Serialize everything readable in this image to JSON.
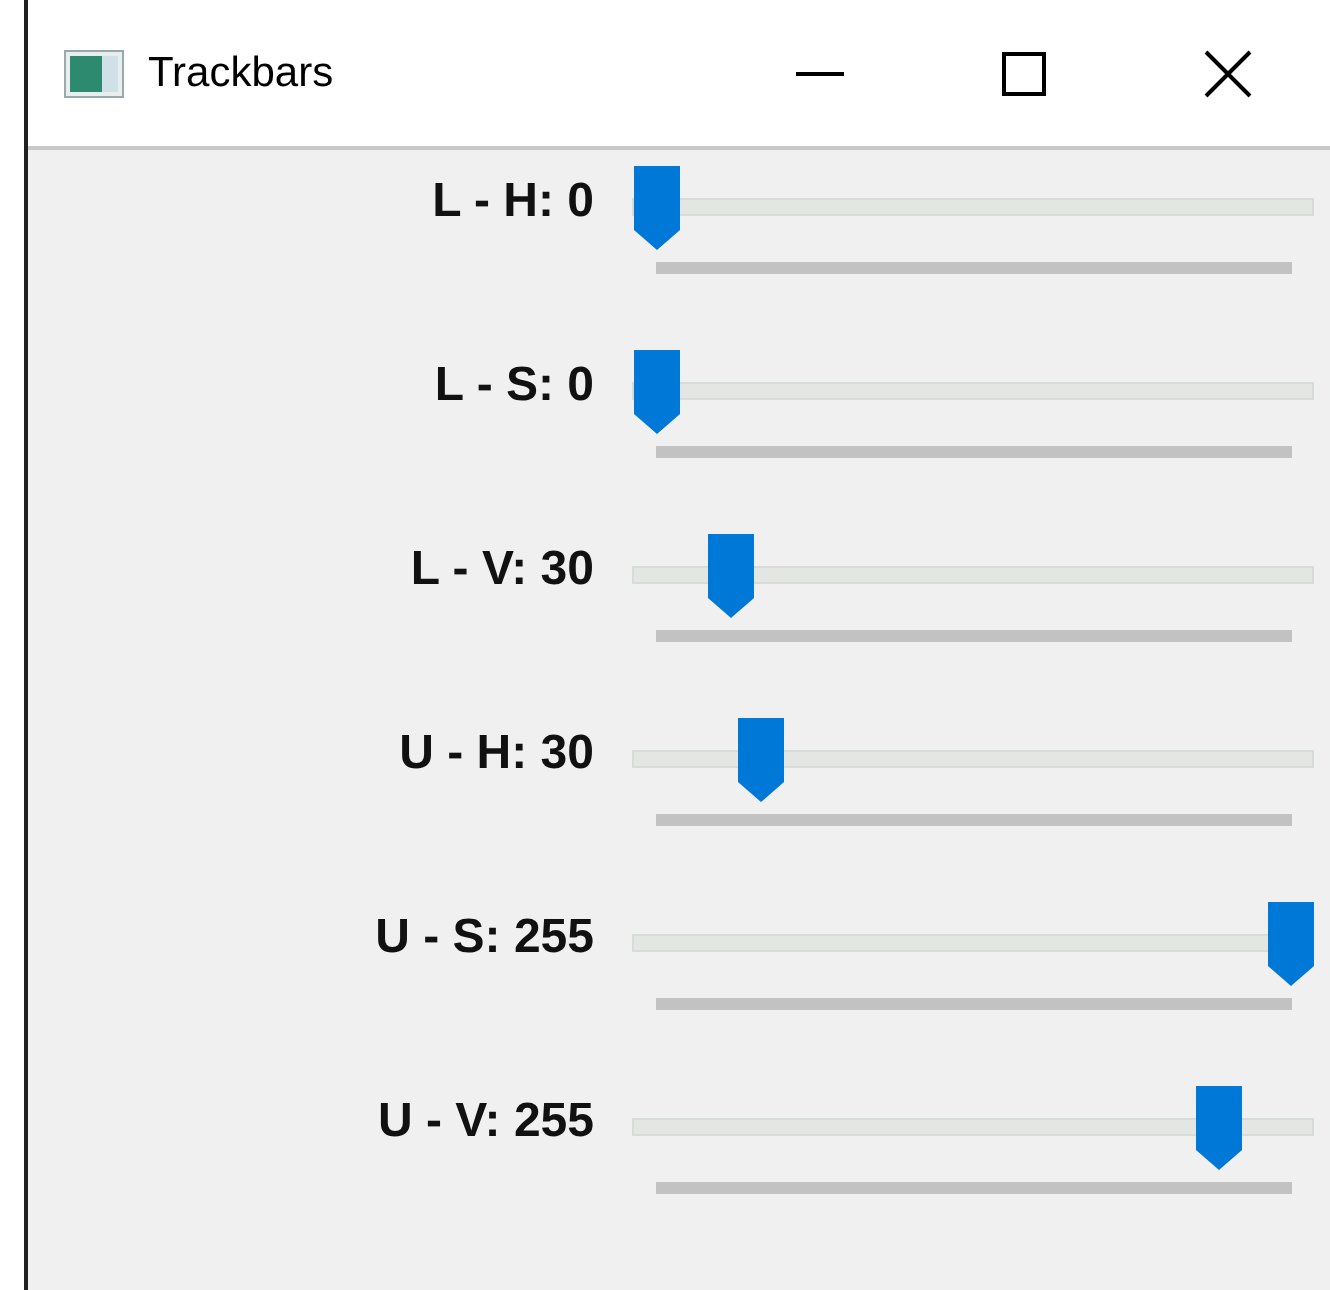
{
  "window": {
    "title": "Trackbars"
  },
  "trackbars": [
    {
      "label": "L - H: 0",
      "level": 0
    },
    {
      "label": "L - S: 0",
      "level": 0
    },
    {
      "label": "L - V: 30",
      "level": 0.117
    },
    {
      "label": "U - H: 30",
      "level": 0.164
    },
    {
      "label": "U - S: 255",
      "level": 1
    },
    {
      "label": "U - V: 255",
      "level": 0.886
    }
  ]
}
